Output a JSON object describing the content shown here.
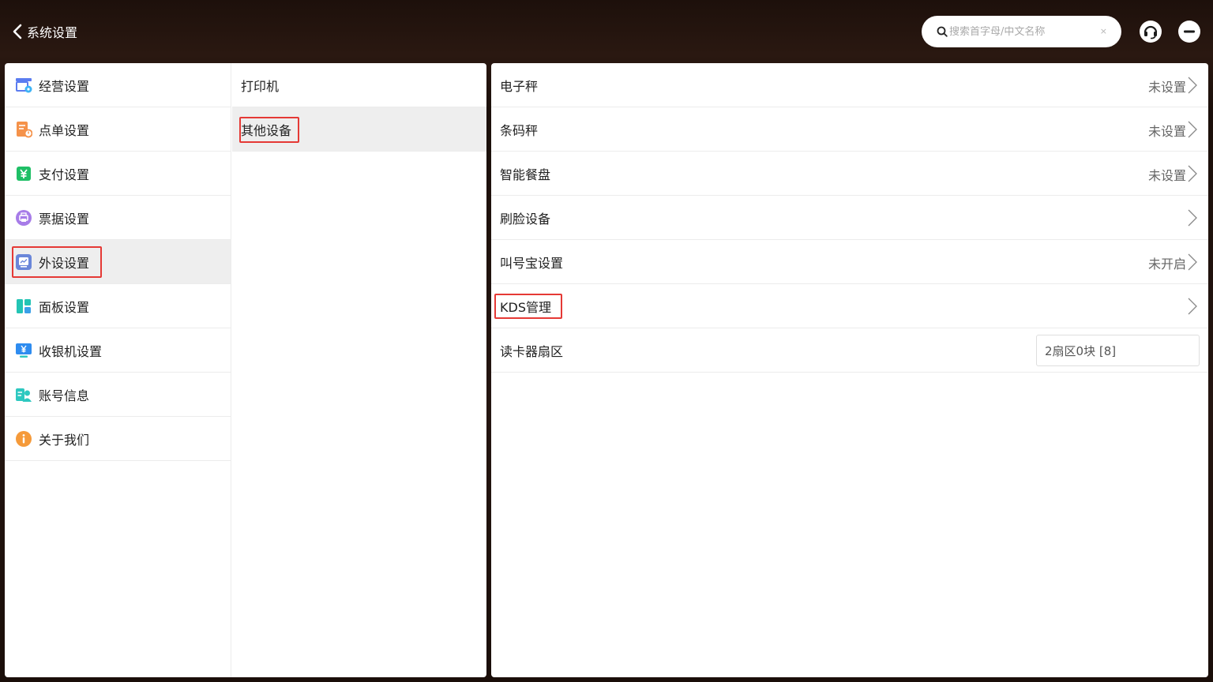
{
  "header": {
    "back_label": "系统设置",
    "search_placeholder": "搜索首字母/中文名称",
    "search_clear": "×"
  },
  "categories": [
    {
      "label": "经营设置",
      "icon": "store-icon",
      "color": "#5b7cf0"
    },
    {
      "label": "点单设置",
      "icon": "order-icon",
      "color": "#f5924a"
    },
    {
      "label": "支付设置",
      "icon": "payment-icon",
      "color": "#1fbf66"
    },
    {
      "label": "票据设置",
      "icon": "printer-icon",
      "color": "#a77ce8"
    },
    {
      "label": "外设设置",
      "icon": "peripheral-icon",
      "color": "#6a86d9"
    },
    {
      "label": "面板设置",
      "icon": "panel-icon",
      "color": "#23c4b4"
    },
    {
      "label": "收银机设置",
      "icon": "cashier-icon",
      "color": "#2e8cf0"
    },
    {
      "label": "账号信息",
      "icon": "account-icon",
      "color": "#2ec8c0"
    },
    {
      "label": "关于我们",
      "icon": "info-icon",
      "color": "#f59a3a"
    }
  ],
  "subcategories": [
    {
      "label": "打印机"
    },
    {
      "label": "其他设备"
    }
  ],
  "settings": [
    {
      "label": "电子秤",
      "value": "未设置"
    },
    {
      "label": "条码秤",
      "value": "未设置"
    },
    {
      "label": "智能餐盘",
      "value": "未设置"
    },
    {
      "label": "刷脸设备",
      "value": ""
    },
    {
      "label": "叫号宝设置",
      "value": "未开启"
    },
    {
      "label": "KDS管理",
      "value": ""
    },
    {
      "label": "读卡器扇区",
      "field_value": "2扇区0块 [8]"
    }
  ],
  "colors": {
    "highlight": "#e53935",
    "active_bg": "#eeeeee"
  }
}
